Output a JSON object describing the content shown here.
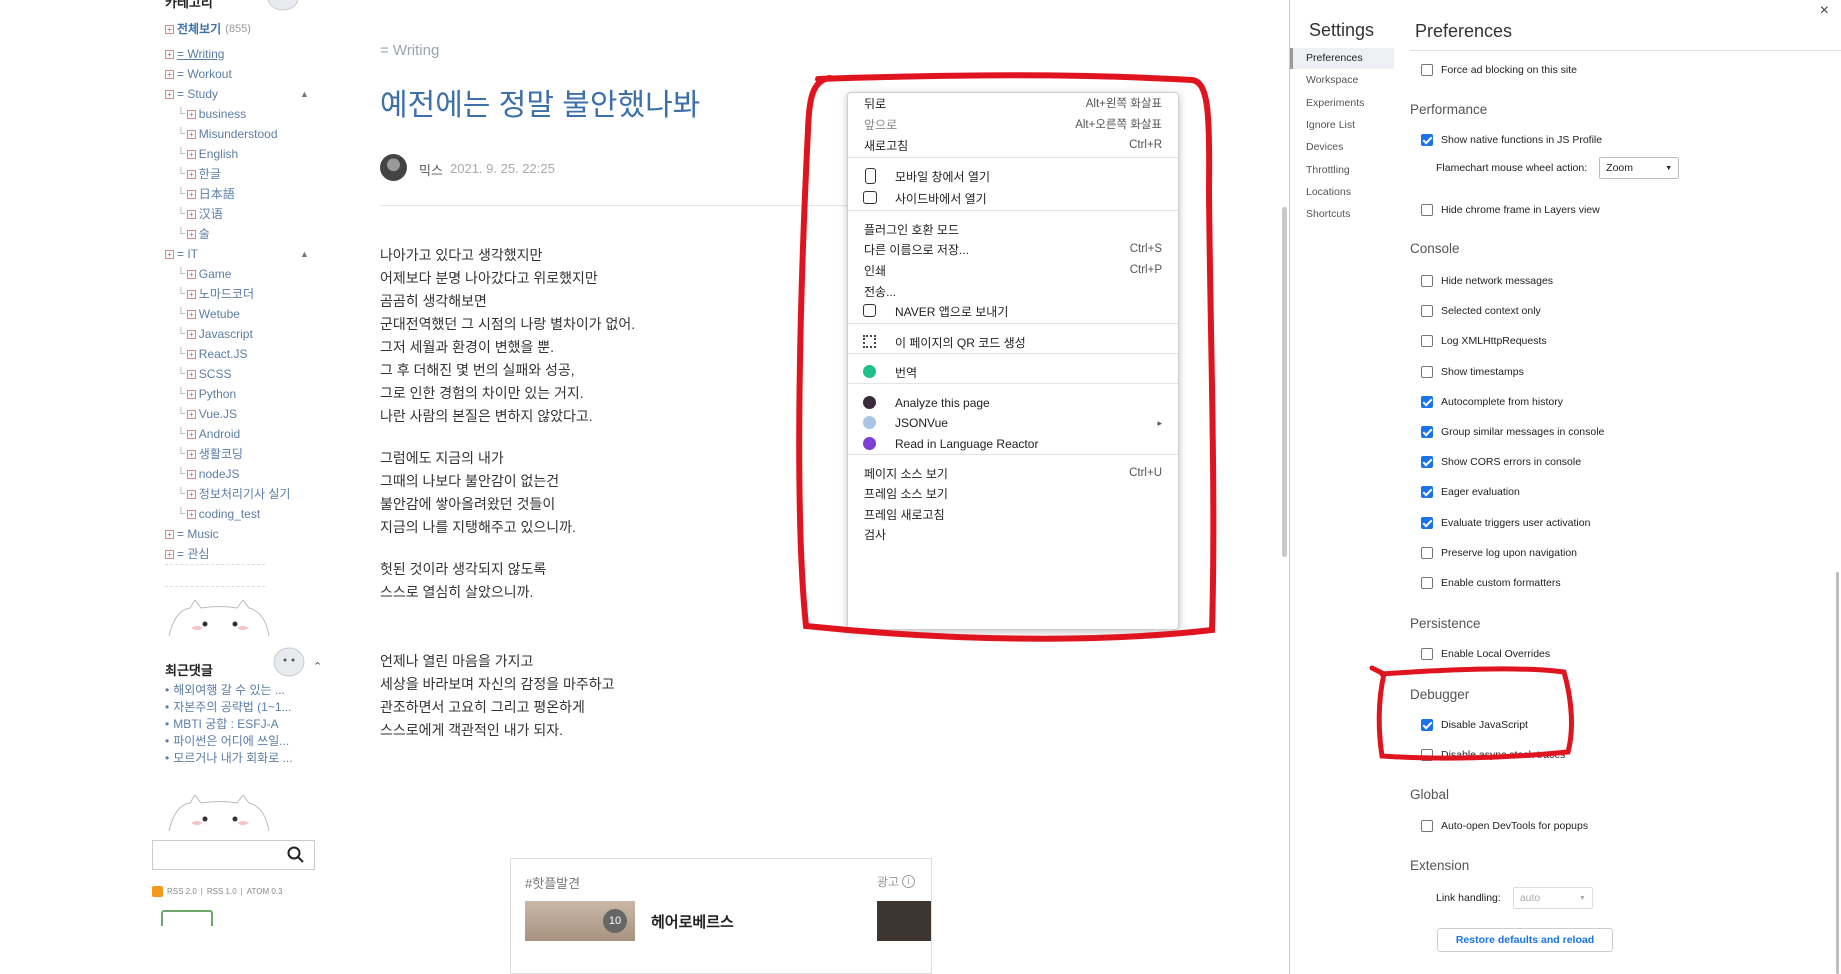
{
  "sidebar": {
    "header_label": "카테고리",
    "all": {
      "label": "전체보기",
      "count": "(855)"
    },
    "categories": [
      {
        "label": "= Writing",
        "level": 0,
        "underline": true
      },
      {
        "label": "= Workout",
        "level": 0
      },
      {
        "label": "= Study",
        "level": 0,
        "arrow": "▲"
      },
      {
        "label": "business",
        "level": 1
      },
      {
        "label": "Misunderstood",
        "level": 1
      },
      {
        "label": "English",
        "level": 1
      },
      {
        "label": "한글",
        "level": 1
      },
      {
        "label": "日本語",
        "level": 1
      },
      {
        "label": "汉语",
        "level": 1
      },
      {
        "label": "술",
        "level": 1
      },
      {
        "label": "= IT",
        "level": 0,
        "arrow": "▲"
      },
      {
        "label": "Game",
        "level": 1
      },
      {
        "label": "노마드코더",
        "level": 1
      },
      {
        "label": "Wetube",
        "level": 1
      },
      {
        "label": "Javascript",
        "level": 1
      },
      {
        "label": "React.JS",
        "level": 1
      },
      {
        "label": "SCSS",
        "level": 1
      },
      {
        "label": "Python",
        "level": 1
      },
      {
        "label": "Vue.JS",
        "level": 1
      },
      {
        "label": "Android",
        "level": 1
      },
      {
        "label": "생활코딩",
        "level": 1
      },
      {
        "label": "nodeJS",
        "level": 1
      },
      {
        "label": "정보처리기사 실기",
        "level": 1
      },
      {
        "label": "coding_test",
        "level": 1
      },
      {
        "label": "= Music",
        "level": 0
      },
      {
        "label": "= 관심",
        "level": 0
      }
    ],
    "recent_comments_title": "최근댓글",
    "recent_comments_arrow": "⌃",
    "recent_comments": [
      "해외여행 갈 수 있는 ...",
      "자본주의 공략법 (1~1...",
      "MBTI 궁합 : ESFJ-A",
      "파이썬은 어디에 쓰일...",
      "모르거나 내가 회화로 ..."
    ],
    "search_placeholder": "",
    "feeds": {
      "rss2": "RSS 2.0",
      "rss1": "RSS 1.0",
      "atom": "ATOM 0.3"
    }
  },
  "post": {
    "category": "= Writing",
    "title": "예전에는 정말 불안했나봐",
    "author": "믹스",
    "date": "2021. 9. 25. 22:25",
    "stanzas": [
      [
        "나아가고 있다고 생각했지만",
        "어제보다 분명 나아갔다고 위로했지만",
        "곰곰히 생각해보면",
        "군대전역했던 그 시점의 나랑 별차이가 없어.",
        "그저 세월과 환경이 변했을 뿐.",
        "그 후 더해진 몇 번의 실패와 성공,",
        "그로 인한 경험의 차이만 있는 거지.",
        "나란 사람의 본질은 변하지 않았다고."
      ],
      [
        "그럼에도 지금의 내가",
        "그때의 나보다 불안감이 없는건",
        "불안감에 쌓아올려왔던 것들이",
        "지금의 나를 지탱해주고 있으니까."
      ],
      [
        "헛된 것이라 생각되지 않도록",
        "스스로 열심히 살았으니까."
      ],
      [
        "언제나 열린 마음을 가지고",
        "세상을 바라보며 자신의 감정을 마주하고",
        "관조하면서 고요히 그리고 평온하게",
        "스스로에게 객관적인 내가 되자."
      ]
    ],
    "ad_box": {
      "hashtag": "#핫플발견",
      "ad_label": "광고",
      "badge": "10",
      "item_title": "헤어로베르스"
    }
  },
  "context_menu": {
    "items": [
      {
        "label": "뒤로",
        "shortcut": "Alt+왼쪽 화살표"
      },
      {
        "label": "앞으로",
        "shortcut": "Alt+오른쪽 화살표",
        "disabled": true
      },
      {
        "label": "새로고침",
        "shortcut": "Ctrl+R"
      },
      {
        "label": "모바일 창에서 열기",
        "icon": "mobile-icon"
      },
      {
        "label": "사이드바에서 열기",
        "icon": "sidebar-icon"
      },
      {
        "label": "플러그인 호환 모드"
      },
      {
        "label": "다른 이름으로 저장...",
        "shortcut": "Ctrl+S"
      },
      {
        "label": "인쇄",
        "shortcut": "Ctrl+P"
      },
      {
        "label": "전송..."
      },
      {
        "label": "NAVER 앱으로 보내기",
        "icon": "phone-send-icon"
      },
      {
        "label": "이 페이지의 QR 코드 생성",
        "icon": "qr-code-icon"
      },
      {
        "label": "번역",
        "icon": "papago-icon"
      },
      {
        "label": "Analyze this page",
        "icon": "analyze-icon"
      },
      {
        "label": "JSONVue",
        "icon": "jsonvue-icon",
        "submenu": "▸"
      },
      {
        "label": "Read in Language Reactor",
        "icon": "language-reactor-icon"
      },
      {
        "label": "페이지 소스 보기",
        "shortcut": "Ctrl+U"
      },
      {
        "label": "프레임 소스 보기"
      },
      {
        "label": "프레임 새로고침"
      },
      {
        "label": "검사"
      }
    ]
  },
  "devtools": {
    "close": "×",
    "settings_title": "Settings",
    "nav": [
      "Preferences",
      "Workspace",
      "Experiments",
      "Ignore List",
      "Devices",
      "Throttling",
      "Locations",
      "Shortcuts"
    ],
    "active_nav": "Preferences",
    "page_title": "Preferences",
    "force_ad": {
      "label": "Force ad blocking on this site",
      "checked": false
    },
    "performance": {
      "title": "Performance",
      "native": {
        "label": "Show native functions in JS Profile",
        "checked": true
      },
      "flamechart_label": "Flamechart mouse wheel action:",
      "flamechart_value": "Zoom",
      "chrome_frame": {
        "label": "Hide chrome frame in Layers view",
        "checked": false
      }
    },
    "console": {
      "title": "Console",
      "options": [
        {
          "label": "Hide network messages",
          "checked": false
        },
        {
          "label": "Selected context only",
          "checked": false
        },
        {
          "label": "Log XMLHttpRequests",
          "checked": false
        },
        {
          "label": "Show timestamps",
          "checked": false
        },
        {
          "label": "Autocomplete from history",
          "checked": true
        },
        {
          "label": "Group similar messages in console",
          "checked": true
        },
        {
          "label": "Show CORS errors in console",
          "checked": true
        },
        {
          "label": "Eager evaluation",
          "checked": true
        },
        {
          "label": "Evaluate triggers user activation",
          "checked": true
        },
        {
          "label": "Preserve log upon navigation",
          "checked": false
        },
        {
          "label": "Enable custom formatters",
          "checked": false
        }
      ]
    },
    "persistence": {
      "title": "Persistence",
      "local_overrides": {
        "label": "Enable Local Overrides",
        "checked": false
      }
    },
    "debugger": {
      "title": "Debugger",
      "disable_js": {
        "label": "Disable JavaScript",
        "checked": true
      },
      "async": {
        "label": "Disable async stack traces",
        "checked": false
      }
    },
    "global": {
      "title": "Global",
      "auto_open": {
        "label": "Auto-open DevTools for popups",
        "checked": false
      }
    },
    "extension": {
      "title": "Extension",
      "link_label": "Link handling:",
      "link_value": "auto"
    },
    "restore_button": "Restore defaults and reload"
  },
  "colors": {
    "annotation_red": "#e0141e",
    "link_blue": "#5b7da6",
    "title_blue": "#3d6fa8",
    "checkbox_blue": "#1a73e8"
  }
}
